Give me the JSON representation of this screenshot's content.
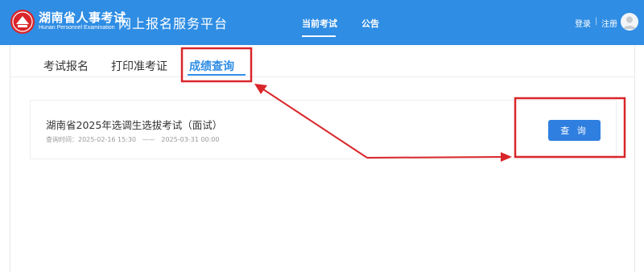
{
  "header": {
    "logo_cn": "湖南省人事考试",
    "logo_en": "Hunan Personnel Examination",
    "site_title": "网上报名服务平台",
    "nav": [
      "当前考试",
      "公告"
    ],
    "login": "登录",
    "separator": "|",
    "register": "注册"
  },
  "tabs": [
    "考试报名",
    "打印准考证",
    "成绩查询"
  ],
  "active_tab": "成绩查询",
  "exam": {
    "title": "湖南省2025年选调生选拔考试（面试）",
    "time_label": "查询时间：",
    "time_start": "2025-02-16 15:30",
    "time_dash": "——",
    "time_end": "2025-03-31 00:00",
    "button": "查 询"
  },
  "colors": {
    "header_bg": "#2f8de4",
    "accent": "#2f8de4",
    "button": "#2f7fe0",
    "annotation": "#d9262a"
  },
  "icons": [
    "emblem-logo-icon",
    "avatar-icon"
  ]
}
